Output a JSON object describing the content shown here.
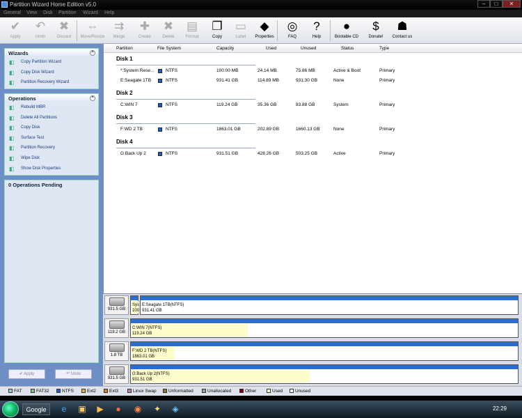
{
  "window": {
    "title": "Partition Wizard Home Edition v5.0",
    "minimize": "–",
    "maximize": "□",
    "close": "✕"
  },
  "menu": [
    "General",
    "View",
    "Disk",
    "Partition",
    "Wizard",
    "Help"
  ],
  "toolbar": [
    {
      "label": "Apply",
      "icon": "check-icon",
      "glyph": "✔",
      "enabled": false
    },
    {
      "label": "Undo",
      "icon": "undo-icon",
      "glyph": "↶",
      "enabled": false
    },
    {
      "label": "Discard",
      "icon": "discard-icon",
      "glyph": "✖",
      "enabled": false
    },
    {
      "label": "Move/Resize",
      "icon": "move-resize-icon",
      "glyph": "⇔",
      "enabled": false
    },
    {
      "label": "Merge",
      "icon": "merge-icon",
      "glyph": "⇉",
      "enabled": false
    },
    {
      "label": "Create",
      "icon": "create-icon",
      "glyph": "✚",
      "enabled": false
    },
    {
      "label": "Delete",
      "icon": "delete-icon",
      "glyph": "✖",
      "enabled": false
    },
    {
      "label": "Format",
      "icon": "format-icon",
      "glyph": "▤",
      "enabled": false
    },
    {
      "label": "Copy",
      "icon": "copy-icon",
      "glyph": "❐",
      "enabled": true
    },
    {
      "label": "Label",
      "icon": "label-icon",
      "glyph": "▭",
      "enabled": false
    },
    {
      "label": "Properties",
      "icon": "properties-icon",
      "glyph": "◆",
      "enabled": true
    },
    {
      "label": "FAQ",
      "icon": "faq-lifebuoy-icon",
      "glyph": "◎",
      "enabled": true
    },
    {
      "label": "Help",
      "icon": "help-icon",
      "glyph": "?",
      "enabled": true
    },
    {
      "label": "Bootable CD",
      "icon": "bootable-cd-icon",
      "glyph": "●",
      "enabled": true
    },
    {
      "label": "Donate!",
      "icon": "donate-dollar-icon",
      "glyph": "$",
      "enabled": true
    },
    {
      "label": "Contact us",
      "icon": "contact-icon",
      "glyph": "☗",
      "enabled": true
    }
  ],
  "wizards": {
    "title": "Wizards",
    "items": [
      {
        "label": "Copy Partition Wizard",
        "icon": "copy-partition-wizard-icon"
      },
      {
        "label": "Copy Disk Wizard",
        "icon": "copy-disk-wizard-icon"
      },
      {
        "label": "Partition Recovery Wizard",
        "icon": "partition-recovery-wizard-icon"
      }
    ]
  },
  "operations": {
    "title": "Operations",
    "items": [
      {
        "label": "Rebuild MBR",
        "icon": "rebuild-mbr-icon"
      },
      {
        "label": "Delete All Partitions",
        "icon": "delete-all-partitions-icon"
      },
      {
        "label": "Copy Disk",
        "icon": "copy-disk-icon"
      },
      {
        "label": "Surface Test",
        "icon": "surface-test-icon"
      },
      {
        "label": "Partition Recovery",
        "icon": "partition-recovery-icon"
      },
      {
        "label": "Wipe Disk",
        "icon": "wipe-disk-icon"
      },
      {
        "label": "Show Disk Properties",
        "icon": "show-disk-properties-icon"
      }
    ]
  },
  "pending": {
    "title": "0 Operations Pending"
  },
  "bottom_buttons": {
    "apply": "Apply",
    "undo": "Undo"
  },
  "columns": [
    "Partition",
    "File System",
    "Capacity",
    "Used",
    "Unused",
    "Status",
    "Type"
  ],
  "disks": [
    {
      "name": "Disk 1",
      "partitions": [
        {
          "partition": "*:System Rese...",
          "fs": "NTFS",
          "capacity": "100.00 MB",
          "used": "24.14 MB",
          "unused": "75.86 MB",
          "status": "Active & Boot",
          "type": "Primary"
        },
        {
          "partition": "E:Seagate 1TB",
          "fs": "NTFS",
          "capacity": "931.41 GB",
          "used": "114.89 MB",
          "unused": "931.30 GB",
          "status": "None",
          "type": "Primary"
        }
      ]
    },
    {
      "name": "Disk 2",
      "partitions": [
        {
          "partition": "C:WIN 7",
          "fs": "NTFS",
          "capacity": "119.24 GB",
          "used": "35.36 GB",
          "unused": "83.88 GB",
          "status": "System",
          "type": "Primary"
        }
      ]
    },
    {
      "name": "Disk 3",
      "partitions": [
        {
          "partition": "F:WD 2 TB",
          "fs": "NTFS",
          "capacity": "1863.01 GB",
          "used": "202.89 GB",
          "unused": "1660.13 GB",
          "status": "None",
          "type": "Primary"
        }
      ]
    },
    {
      "name": "Disk 4",
      "partitions": [
        {
          "partition": "G:Back Up 2",
          "fs": "NTFS",
          "capacity": "931.51 GB",
          "used": "428.26 GB",
          "unused": "503.25 GB",
          "status": "Active",
          "type": "Primary"
        }
      ]
    }
  ],
  "disk_map": [
    {
      "size": "931.5 GB",
      "parts": [
        {
          "line1": "Sys",
          "line2": "100",
          "used_fraction": 1.0,
          "share": 0.025
        },
        {
          "line1": "E:Seagate 1TB(NTFS)",
          "line2": "931.41 GB",
          "used_fraction": 0.0,
          "share": 0.975
        }
      ]
    },
    {
      "size": "119.2 GB",
      "parts": [
        {
          "line1": "C:WIN 7(NTFS)",
          "line2": "119.24 GB",
          "used_fraction": 0.3,
          "share": 1.0
        }
      ]
    },
    {
      "size": "1.8 TB",
      "parts": [
        {
          "line1": "F:WD 2 TB(NTFS)",
          "line2": "1863.01 GB",
          "used_fraction": 0.11,
          "share": 1.0
        }
      ]
    },
    {
      "size": "931.5 GB",
      "parts": [
        {
          "line1": "G:Back Up 2(NTFS)",
          "line2": "931.51 GB",
          "used_fraction": 0.46,
          "share": 1.0
        }
      ]
    }
  ],
  "legend": [
    {
      "label": "FAT",
      "color": "#8fd0d0"
    },
    {
      "label": "FAT32",
      "color": "#7fc97f"
    },
    {
      "label": "NTFS",
      "color": "#1f5fbf"
    },
    {
      "label": "Ext2",
      "color": "#e0b050"
    },
    {
      "label": "Ext3",
      "color": "#d08030"
    },
    {
      "label": "Linux Swap",
      "color": "#c080c0"
    },
    {
      "label": "Unformatted",
      "color": "#8a7a30"
    },
    {
      "label": "Unallocated",
      "color": "#a0a0a0"
    },
    {
      "label": "Other",
      "color": "#800000"
    },
    {
      "label": "Used",
      "color": "#fffccc"
    },
    {
      "label": "Unused",
      "color": "#ffffff"
    }
  ],
  "taskbar": {
    "search_label": "Google",
    "clock": "22:29"
  }
}
